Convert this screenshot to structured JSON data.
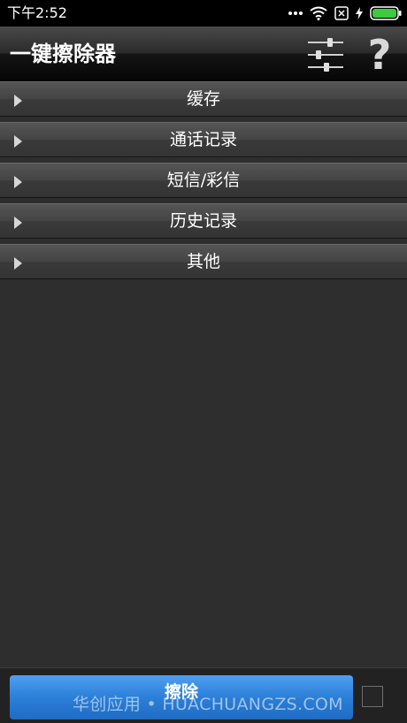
{
  "status_bar": {
    "time": "下午2:52",
    "icons": [
      "more-dots-icon",
      "wifi-icon",
      "no-sim-icon",
      "charging-bolt-icon",
      "battery-icon"
    ],
    "battery_color": "#3ccb3c"
  },
  "header": {
    "title": "一键擦除器",
    "settings_icon": "sliders-icon",
    "help_label": "?"
  },
  "categories": [
    {
      "label": "缓存"
    },
    {
      "label": "通话记录"
    },
    {
      "label": "短信/彩信"
    },
    {
      "label": "历史记录"
    },
    {
      "label": "其他"
    }
  ],
  "bottom_bar": {
    "erase_label": "擦除",
    "watermark": "华创应用 • HUACHUANGZS.COM",
    "accent_color": "#2c7fd8"
  }
}
